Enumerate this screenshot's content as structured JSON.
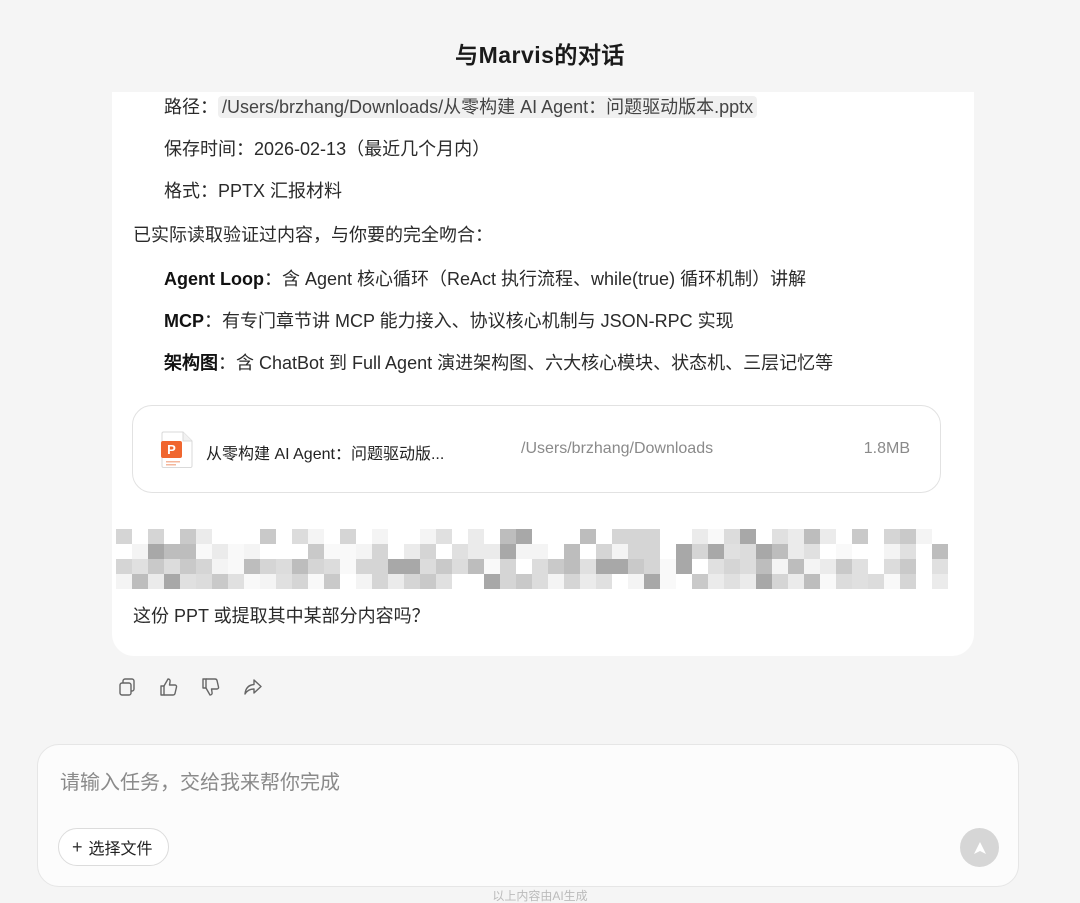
{
  "header": {
    "title": "与Marvis的对话"
  },
  "message": {
    "path_label": "路径：",
    "path_value": "/Users/brzhang/Downloads/从零构建 AI Agent：问题驱动版本.pptx",
    "save_time": "保存时间：2026-02-13（最近几个月内）",
    "format": "格式：PPTX 汇报材料",
    "verified_intro": "已实际读取验证过内容，与你要的完全吻合：",
    "bullets": [
      {
        "key": "Agent Loop",
        "text": "：含 Agent 核心循环（ReAct 执行流程、while(true) 循环机制）讲解"
      },
      {
        "key": "MCP",
        "text": "：有专门章节讲 MCP 能力接入、协议核心机制与 JSON-RPC 实现"
      },
      {
        "key": "架构图",
        "text": "：含 ChatBot 到 Full Agent 演进架构图、六大核心模块、状态机、三层记忆等"
      }
    ],
    "closing": "这份 PPT 或提取其中某部分内容吗？"
  },
  "file_card": {
    "icon": "pptx-file-icon",
    "icon_letter": "P",
    "name": "从零构建 AI Agent：问题驱动版...",
    "path": "/Users/brzhang/Downloads",
    "size": "1.8MB"
  },
  "actions": {
    "icons": [
      "copy-icon",
      "thumbs-up-icon",
      "thumbs-down-icon",
      "share-icon"
    ]
  },
  "composer": {
    "placeholder": "请输入任务，交给我来帮你完成",
    "choose_file_label": "选择文件",
    "send_icon": "send-arrow-icon"
  },
  "footer": {
    "note": "以上内容由AI生成"
  },
  "colors": {
    "background": "#f5f5f5",
    "card": "#ffffff",
    "ppt_orange": "#f0662f",
    "send_disabled": "#d6d6d6"
  }
}
